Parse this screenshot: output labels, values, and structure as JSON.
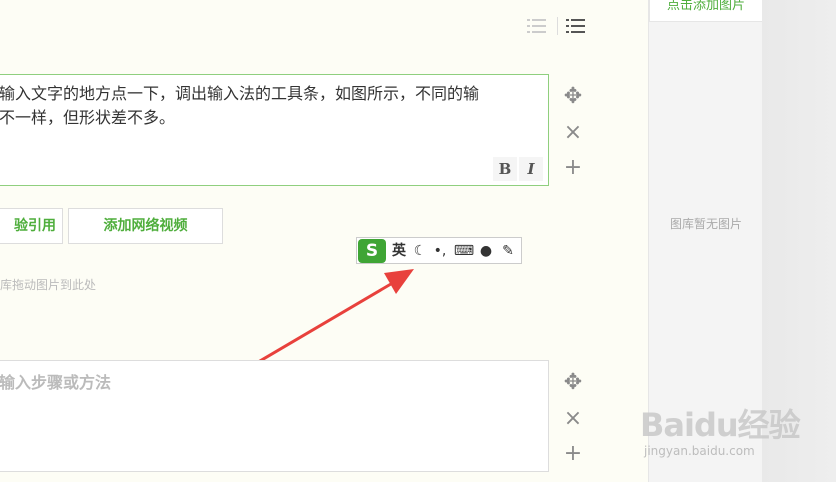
{
  "toolbar": {
    "ordered_list_icon": "ordered-list-icon",
    "unordered_list_icon": "unordered-list-icon"
  },
  "step1": {
    "line1": "输入文字的地方点一下，调出输入法的工具条，如图所示，不同的输",
    "line2": "不一样，但形状差不多。",
    "bold_label": "B",
    "italic_label": "I"
  },
  "step_controls": {
    "move": "✥",
    "delete": "×",
    "add": "+"
  },
  "buttons": {
    "cite": "验引用",
    "video": "添加网络视频"
  },
  "drag_hint": "库拖动图片到此处",
  "ime": {
    "logo": "S",
    "lang": "英",
    "items": [
      "☾",
      "•,",
      "⌨",
      "●",
      "✎"
    ],
    "accent": "#3fa535"
  },
  "step2": {
    "placeholder": "输入步骤或方法"
  },
  "right_panel": {
    "add_image": "点击添加图片",
    "empty": "图库暂无图片"
  },
  "watermark": {
    "brand": "Baidu经验",
    "url": "jingyan.baidu.com"
  },
  "colors": {
    "accent_green": "#4fae3c",
    "arrow_red": "#e8413c"
  }
}
